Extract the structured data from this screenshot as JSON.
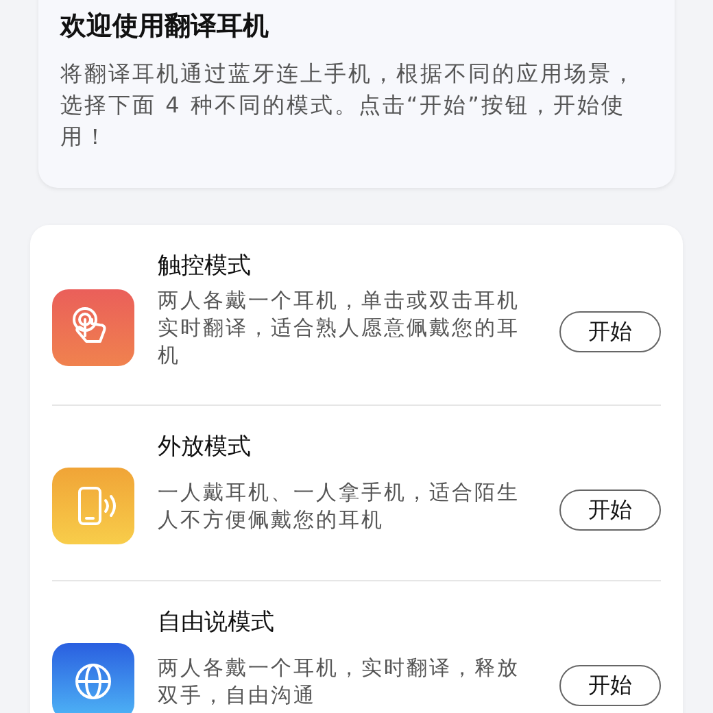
{
  "intro": {
    "title": "欢迎使用翻译耳机",
    "text": "将翻译耳机通过蓝牙连上手机，根据不同的应用场景，选择下面 4 种不同的模式。点击“开始”按钮，开始使用！"
  },
  "modes": [
    {
      "kind": "touch",
      "title": "触控模式",
      "description": "两人各戴一个耳机，单击或双击耳机实时翻译，适合熟人愿意佩戴您的耳机",
      "button": "开始"
    },
    {
      "kind": "speaker",
      "title": "外放模式",
      "description": "一人戴耳机、一人拿手机，适合陌生人不方便佩戴您的耳机",
      "button": "开始"
    },
    {
      "kind": "free",
      "title": "自由说模式",
      "description": "两人各戴一个耳机，实时翻译，释放双手，自由沟通",
      "button": "开始"
    }
  ]
}
